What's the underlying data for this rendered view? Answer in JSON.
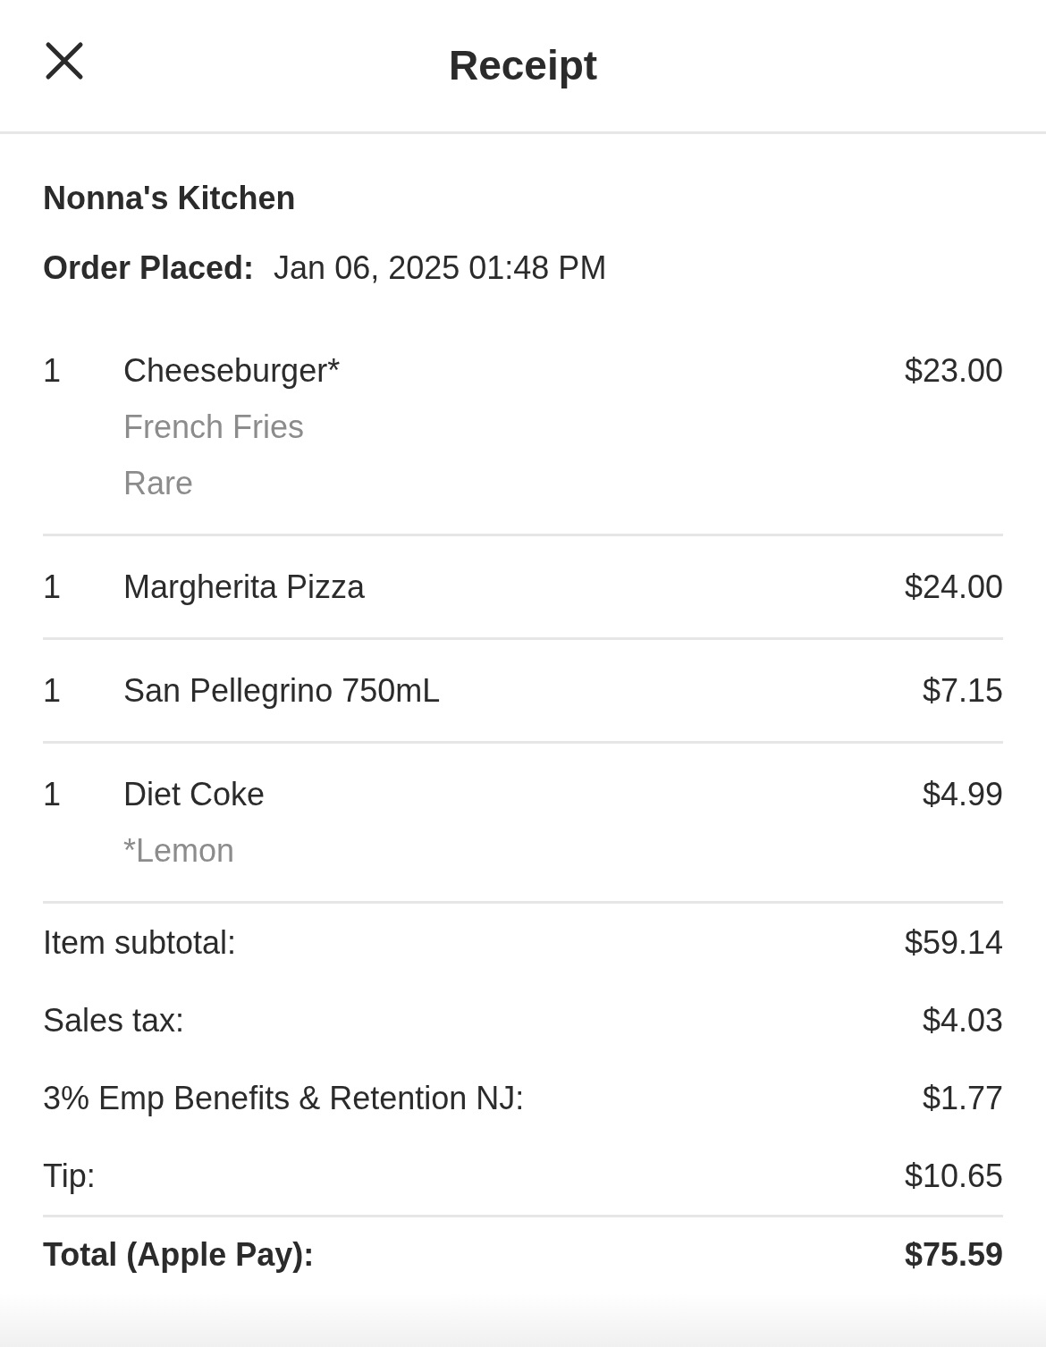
{
  "header": {
    "title": "Receipt"
  },
  "restaurant": "Nonna's Kitchen",
  "order_placed": {
    "label": "Order Placed:",
    "value": "Jan 06, 2025 01:48 PM"
  },
  "items": [
    {
      "qty": "1",
      "name": "Cheeseburger*",
      "modifiers": [
        "French Fries",
        "Rare"
      ],
      "price": "$23.00"
    },
    {
      "qty": "1",
      "name": "Margherita Pizza",
      "price": "$24.00"
    },
    {
      "qty": "1",
      "name": "San Pellegrino 750mL",
      "price": "$7.15"
    },
    {
      "qty": "1",
      "name": "Diet Coke",
      "modifiers": [
        "*Lemon"
      ],
      "price": "$4.99"
    }
  ],
  "summary": [
    {
      "label": "Item subtotal:",
      "value": "$59.14"
    },
    {
      "label": "Sales tax:",
      "value": "$4.03"
    },
    {
      "label": "3% Emp Benefits & Retention NJ:",
      "value": "$1.77"
    },
    {
      "label": "Tip:",
      "value": "$10.65"
    }
  ],
  "total": {
    "label": "Total (Apple Pay):",
    "value": "$75.59"
  }
}
